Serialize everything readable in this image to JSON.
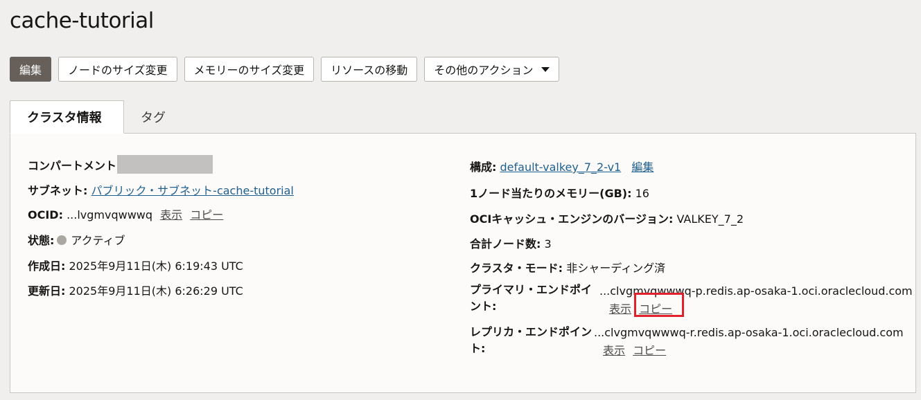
{
  "page": {
    "title": "cache-tutorial"
  },
  "toolbar": {
    "edit": "編集",
    "resize_nodes": "ノードのサイズ変更",
    "resize_memory": "メモリーのサイズ変更",
    "move_resource": "リソースの移動",
    "more_actions": "その他のアクション"
  },
  "tabs": [
    {
      "label": "クラスタ情報",
      "active": true
    },
    {
      "label": "タグ",
      "active": false
    }
  ],
  "info": {
    "compartment_label": "コンパートメント",
    "subnet_label": "サブネット:",
    "subnet_value": "パブリック・サブネット-cache-tutorial",
    "ocid_label": "OCID:",
    "ocid_value": "...lvgmvqwwwq",
    "show": "表示",
    "copy": "コピー",
    "state_label": "状態:",
    "state_value": "アクティブ",
    "created_label": "作成日:",
    "created_value": "2025年9月11日(木) 6:19:43 UTC",
    "updated_label": "更新日:",
    "updated_value": "2025年9月11日(木) 6:26:29 UTC",
    "config_label": "構成:",
    "config_value": "default-valkey_7_2-v1",
    "config_edit": "編集",
    "memory_label": "1ノード当たりのメモリー(GB):",
    "memory_value": "16",
    "engine_label": "OCIキャッシュ・エンジンのバージョン:",
    "engine_value": "VALKEY_7_2",
    "total_nodes_label": "合計ノード数:",
    "total_nodes_value": "3",
    "cluster_mode_label": "クラスタ・モード:",
    "cluster_mode_value": "非シャーディング済",
    "primary_endpoint_label": "プライマリ・エンドポイント:",
    "primary_endpoint_value": "...clvgmvqwwwq-p.redis.ap-osaka-1.oci.oraclecloud.com",
    "replica_endpoint_label": "レプリカ・エンドポイント:",
    "replica_endpoint_value": "...clvgmvqwwwq-r.redis.ap-osaka-1.oci.oraclecloud.com"
  },
  "colors": {
    "primary_button": "#665f5a",
    "link": "#1f5f8f",
    "highlight": "#e0202a",
    "state_dot": "#aaa6a2"
  }
}
